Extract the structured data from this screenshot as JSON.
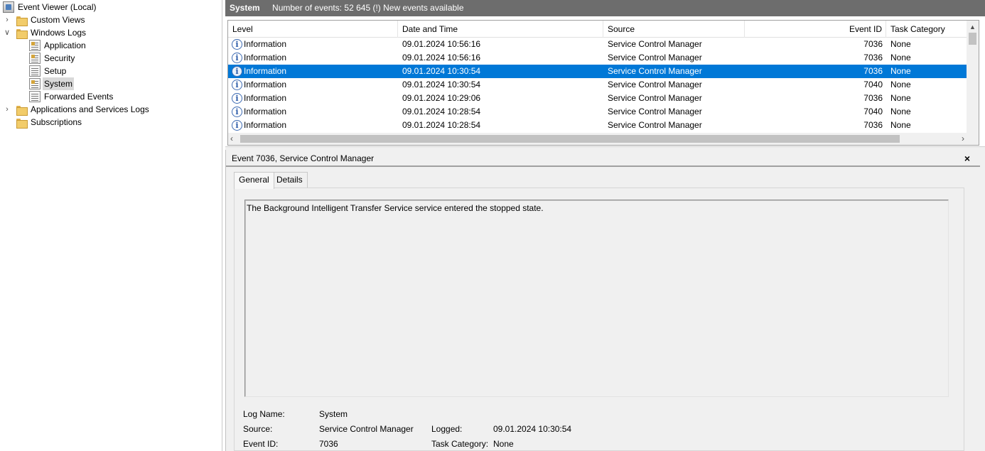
{
  "tree": {
    "root": "Event Viewer (Local)",
    "custom_views": "Custom Views",
    "windows_logs": "Windows Logs",
    "windows_logs_items": [
      "Application",
      "Security",
      "Setup",
      "System",
      "Forwarded Events"
    ],
    "app_services_logs": "Applications and Services Logs",
    "subscriptions": "Subscriptions",
    "selected": "System"
  },
  "header": {
    "title": "System",
    "status": "Number of events: 52 645 (!) New events available"
  },
  "grid": {
    "columns": [
      "Level",
      "Date and Time",
      "Source",
      "Event ID",
      "Task Category"
    ],
    "rows": [
      {
        "level": "Information",
        "datetime": "09.01.2024 10:56:16",
        "source": "Service Control Manager",
        "event_id": "7036",
        "category": "None"
      },
      {
        "level": "Information",
        "datetime": "09.01.2024 10:56:16",
        "source": "Service Control Manager",
        "event_id": "7036",
        "category": "None"
      },
      {
        "level": "Information",
        "datetime": "09.01.2024 10:30:54",
        "source": "Service Control Manager",
        "event_id": "7036",
        "category": "None"
      },
      {
        "level": "Information",
        "datetime": "09.01.2024 10:30:54",
        "source": "Service Control Manager",
        "event_id": "7040",
        "category": "None"
      },
      {
        "level": "Information",
        "datetime": "09.01.2024 10:29:06",
        "source": "Service Control Manager",
        "event_id": "7036",
        "category": "None"
      },
      {
        "level": "Information",
        "datetime": "09.01.2024 10:28:54",
        "source": "Service Control Manager",
        "event_id": "7040",
        "category": "None"
      },
      {
        "level": "Information",
        "datetime": "09.01.2024 10:28:54",
        "source": "Service Control Manager",
        "event_id": "7036",
        "category": "None"
      }
    ],
    "selected_row": 2
  },
  "detail": {
    "title": "Event 7036, Service Control Manager",
    "close": "×",
    "tabs": [
      "General",
      "Details"
    ],
    "message": "The Background Intelligent Transfer Service service entered the stopped state.",
    "labels": {
      "log_name": "Log Name:",
      "source": "Source:",
      "logged": "Logged:",
      "event_id": "Event ID:",
      "task_category": "Task Category:"
    },
    "values": {
      "log_name": "System",
      "source": "Service Control Manager",
      "logged": "09.01.2024 10:30:54",
      "event_id": "7036",
      "task_category": "None"
    }
  },
  "colors": {
    "selection": "#0078d7",
    "header_bar": "#6d6d6d",
    "pane_bg": "#f0f0f0"
  }
}
